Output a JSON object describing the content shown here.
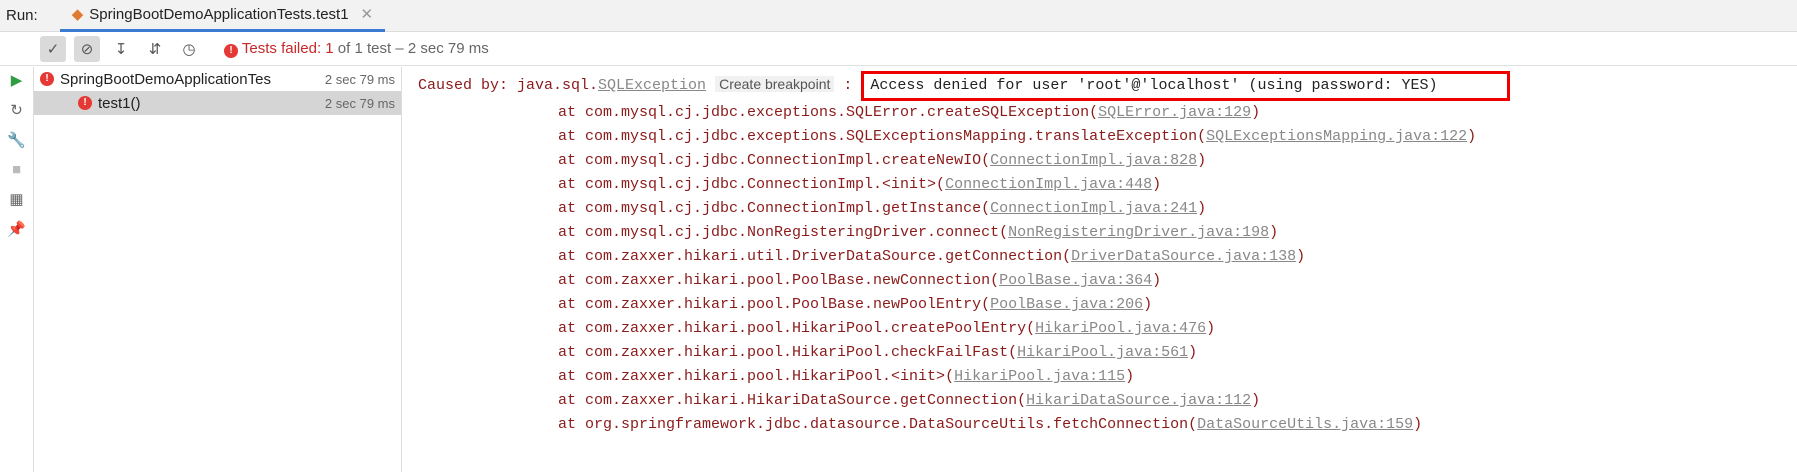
{
  "run": "Run:",
  "tab": "SpringBootDemoApplicationTests.test1",
  "status": {
    "fail": "Tests failed: 1",
    "rest": "of 1 test – 2 sec 79 ms"
  },
  "tree": [
    {
      "l": "SpringBootDemoApplicationTes",
      "t": "2 sec 79 ms"
    },
    {
      "l": "test1()",
      "t": "2 sec 79 ms"
    }
  ],
  "cause": {
    "pre": "Caused by: java.sql.",
    "ex": "SQLException",
    "bp": "Create breakpoint",
    "msg": "Access denied for user 'root'@'localhost' (using password: YES)"
  },
  "trace": [
    [
      "at com.mysql.cj.jdbc.exceptions.SQLError.createSQLException(",
      "SQLError.java:129"
    ],
    [
      "at com.mysql.cj.jdbc.exceptions.SQLExceptionsMapping.translateException(",
      "SQLExceptionsMapping.java:122"
    ],
    [
      "at com.mysql.cj.jdbc.ConnectionImpl.createNewIO(",
      "ConnectionImpl.java:828"
    ],
    [
      "at com.mysql.cj.jdbc.ConnectionImpl.<init>(",
      "ConnectionImpl.java:448"
    ],
    [
      "at com.mysql.cj.jdbc.ConnectionImpl.getInstance(",
      "ConnectionImpl.java:241"
    ],
    [
      "at com.mysql.cj.jdbc.NonRegisteringDriver.connect(",
      "NonRegisteringDriver.java:198"
    ],
    [
      "at com.zaxxer.hikari.util.DriverDataSource.getConnection(",
      "DriverDataSource.java:138"
    ],
    [
      "at com.zaxxer.hikari.pool.PoolBase.newConnection(",
      "PoolBase.java:364"
    ],
    [
      "at com.zaxxer.hikari.pool.PoolBase.newPoolEntry(",
      "PoolBase.java:206"
    ],
    [
      "at com.zaxxer.hikari.pool.HikariPool.createPoolEntry(",
      "HikariPool.java:476"
    ],
    [
      "at com.zaxxer.hikari.pool.HikariPool.checkFailFast(",
      "HikariPool.java:561"
    ],
    [
      "at com.zaxxer.hikari.pool.HikariPool.<init>(",
      "HikariPool.java:115"
    ],
    [
      "at com.zaxxer.hikari.HikariDataSource.getConnection(",
      "HikariDataSource.java:112"
    ],
    [
      "at org.springframework.jdbc.datasource.DataSourceUtils.fetchConnection(",
      "DataSourceUtils.java:159"
    ]
  ]
}
